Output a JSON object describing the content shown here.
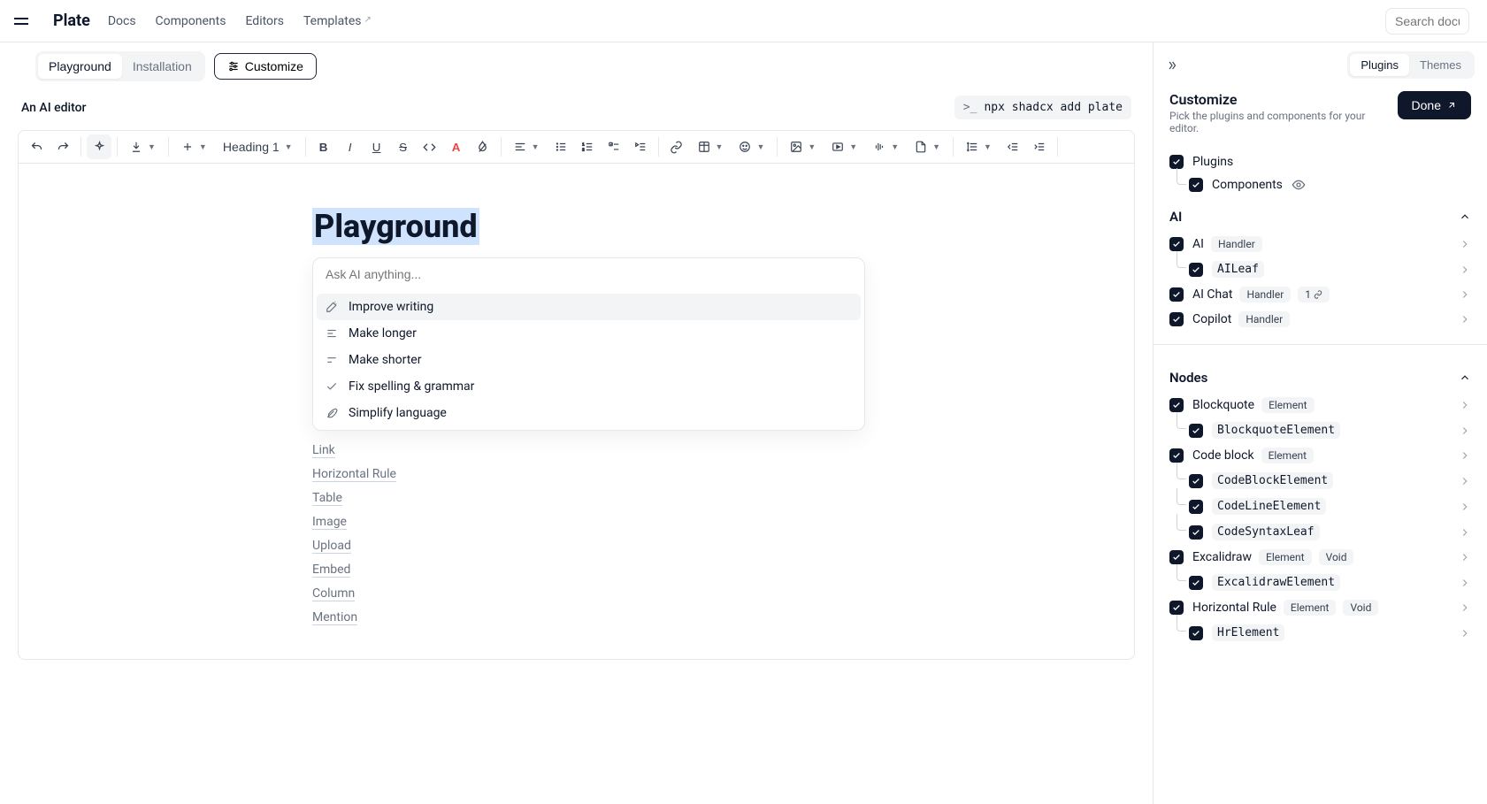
{
  "header": {
    "brand": "Plate",
    "nav": [
      "Docs",
      "Components",
      "Editors",
      "Templates"
    ],
    "search_placeholder": "Search docume"
  },
  "subheader": {
    "tabs": [
      "Playground",
      "Installation"
    ],
    "customize_label": "Customize"
  },
  "page": {
    "subtitle": "An AI editor",
    "command": "npx shadcx add plate"
  },
  "toolbar": {
    "block_label": "Heading 1"
  },
  "doc": {
    "title": "Playground",
    "ai_placeholder": "Ask AI anything...",
    "suggestions": [
      "Improve writing",
      "Make longer",
      "Make shorter",
      "Fix spelling & grammar",
      "Simplify language"
    ],
    "links": [
      "Link",
      "Horizontal Rule",
      "Table",
      "Image",
      "Upload",
      "Embed",
      "Column",
      "Mention"
    ]
  },
  "panel": {
    "tabs": [
      "Plugins",
      "Themes"
    ],
    "title": "Customize",
    "subtitle": "Pick the plugins and components for your editor.",
    "done_label": "Done",
    "root_plugins": "Plugins",
    "root_components": "Components",
    "sections": {
      "ai": {
        "title": "AI",
        "items": [
          {
            "label": "AI",
            "badges": [
              "Handler"
            ],
            "children": [
              "AILeaf"
            ]
          },
          {
            "label": "AI Chat",
            "badges": [
              "Handler",
              "1"
            ],
            "children": []
          },
          {
            "label": "Copilot",
            "badges": [
              "Handler"
            ],
            "children": []
          }
        ]
      },
      "nodes": {
        "title": "Nodes",
        "items": [
          {
            "label": "Blockquote",
            "badges": [
              "Element"
            ],
            "children": [
              "BlockquoteElement"
            ]
          },
          {
            "label": "Code block",
            "badges": [
              "Element"
            ],
            "children": [
              "CodeBlockElement",
              "CodeLineElement",
              "CodeSyntaxLeaf"
            ]
          },
          {
            "label": "Excalidraw",
            "badges": [
              "Element",
              "Void"
            ],
            "children": [
              "ExcalidrawElement"
            ]
          },
          {
            "label": "Horizontal Rule",
            "badges": [
              "Element",
              "Void"
            ],
            "children": [
              "HrElement"
            ]
          }
        ]
      }
    }
  }
}
